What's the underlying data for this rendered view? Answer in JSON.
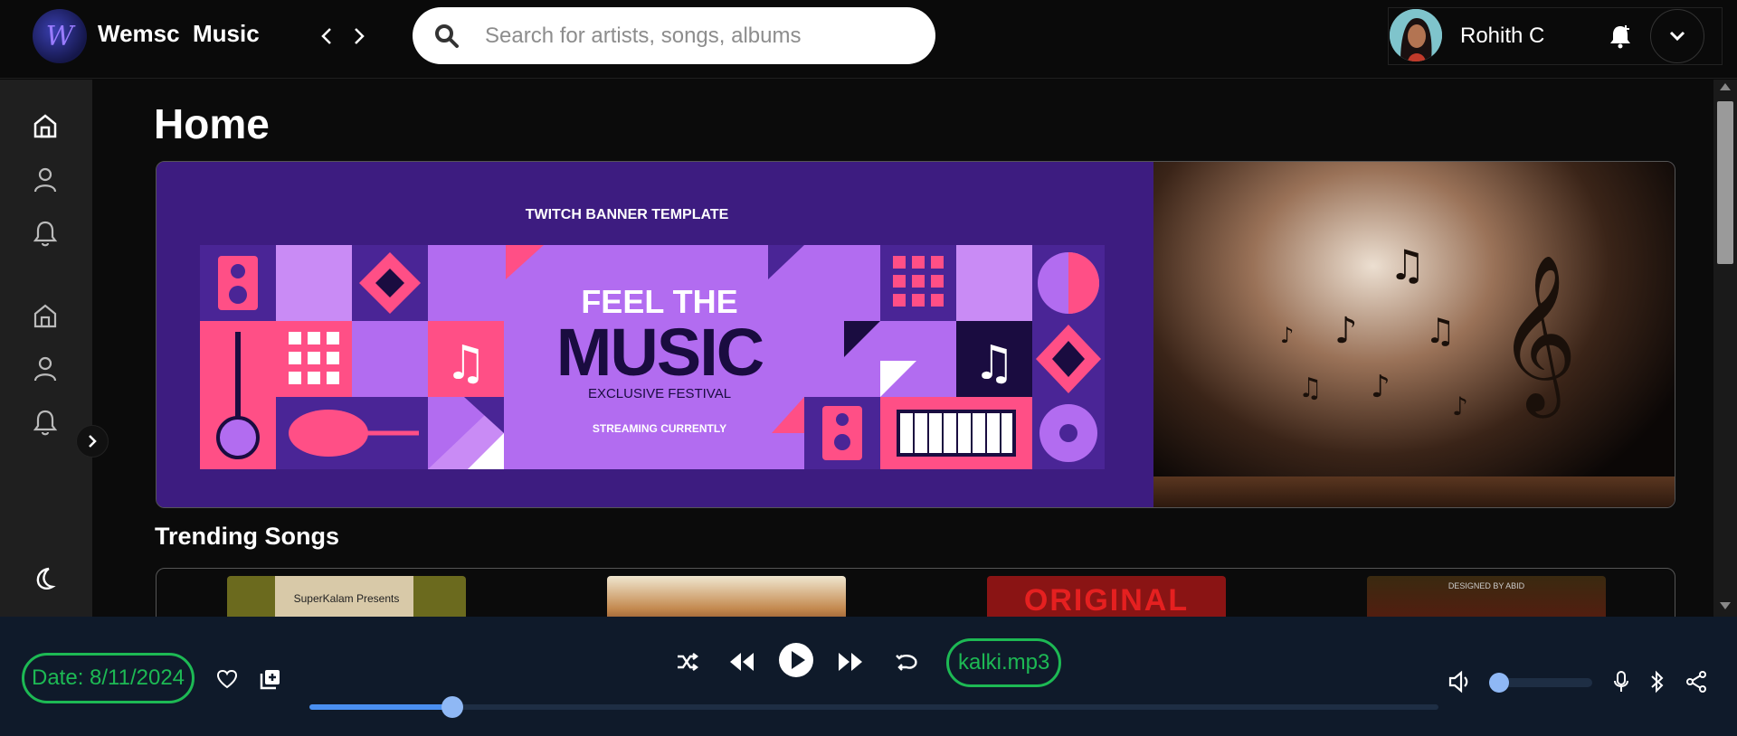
{
  "app": {
    "logo_letter": "W",
    "brand": "Wemsc  Music"
  },
  "search": {
    "placeholder": "Search for artists, songs, albums",
    "value": ""
  },
  "user": {
    "name": "Rohith C"
  },
  "main": {
    "title": "Home",
    "banner": {
      "header": "TWITCH BANNER TEMPLATE",
      "headline_1": "FEEL THE",
      "headline_2": "MUSIC",
      "subtitle": "EXCLUSIVE FESTIVAL",
      "tagline": "STREAMING CURRENTLY"
    },
    "trending_title": "Trending Songs",
    "trending_cards": [
      {
        "text": "SuperKalam Presents"
      },
      {
        "text": ""
      },
      {
        "text": "ORIGINAL"
      },
      {
        "text": "DESIGNED BY ABID"
      }
    ]
  },
  "player": {
    "date": "Date: 8/11/2024",
    "track": "kalki.mp3",
    "progress_fraction": 0.127,
    "volume_fraction": 0.0
  },
  "colors": {
    "accent_green": "#1db954",
    "progress_blue": "#4a8ff0",
    "banner_purple": "#3d1c80",
    "tile_pink": "#ff4f86",
    "tile_violet": "#b26cf0"
  },
  "icons": {
    "sidebar": [
      "home-icon",
      "user-icon",
      "bell-icon",
      "home-icon",
      "user-icon",
      "bell-icon",
      "moon-icon"
    ]
  }
}
